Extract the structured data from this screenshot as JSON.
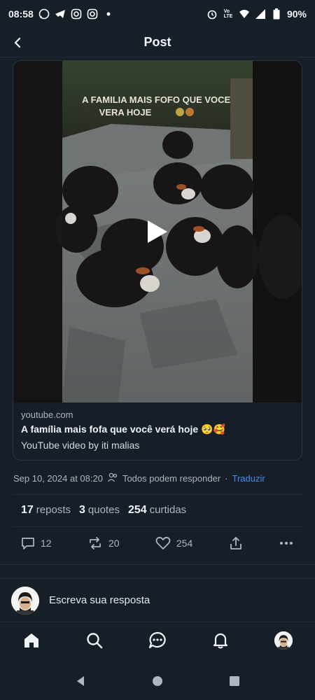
{
  "status_bar": {
    "time": "08:58",
    "left_icons": [
      "whatsapp-icon",
      "telegram-icon",
      "instagram-icon",
      "instagram-icon",
      "dot-icon"
    ],
    "right_icons": [
      "alarm-icon",
      "volte-icon",
      "wifi-icon",
      "signal-icon",
      "battery-icon"
    ],
    "battery": "90%"
  },
  "header": {
    "title": "Post"
  },
  "video_card": {
    "overlay_text": "A FAMILIA MAIS FOFO QUE VOCE VERA HOJE",
    "domain": "youtube.com",
    "title": "A família mais fofa que você verá hoje 🥺🥰",
    "description": "YouTube video by iti malias"
  },
  "meta": {
    "date": "Sep 10, 2024 at 08:20",
    "reply_setting": "Todos podem responder",
    "separator": "·",
    "translate": "Traduzir"
  },
  "stats": {
    "reposts_count": "17",
    "reposts_label": "reposts",
    "quotes_count": "3",
    "quotes_label": "quotes",
    "likes_count": "254",
    "likes_label": "curtidas"
  },
  "actions": {
    "replies": "12",
    "reposts": "20",
    "likes": "254"
  },
  "reply_bar": {
    "placeholder": "Escreva sua resposta"
  },
  "colors": {
    "background": "#161e27",
    "accent": "#3f8ff7",
    "muted": "#aeb6bf"
  }
}
